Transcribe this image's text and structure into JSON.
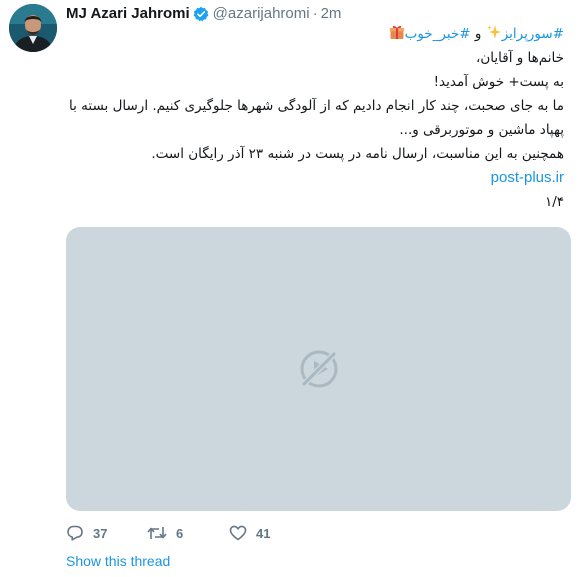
{
  "tweet": {
    "author": {
      "display_name": "MJ Azari Jahromi",
      "handle": "@azarijahromi",
      "verified": true
    },
    "separator": "·",
    "time": "2m",
    "text": {
      "hashtag_1": "#سورپرایز",
      "hashtag_1_emoji": "sparkles-icon",
      "conjunction": "و",
      "hashtag_2": "#خبر_خوب",
      "hashtag_2_emoji": "gift-icon",
      "line_2": "خانم‌ها و آقایان،",
      "line_3": "به پست+ خوش آمدید!",
      "line_4": "ما به جای صحبت، چند کار انجام دادیم که از آلودگی شهرها جلوگیری کنیم. ارسال بسته با",
      "line_5": "پهپاد ماشین و موتوربرقی و...",
      "line_6": "همچنین به این مناسبت، ارسال نامه در پست در شنبه ۲۳ آذر رایگان است.",
      "link": "post-plus.ir",
      "thread_index": "۱/۴"
    },
    "media": {
      "type": "video-placeholder",
      "icon": "video-unavailable-icon",
      "background": "#ccd6dd"
    },
    "actions": {
      "replies": "37",
      "retweets": "6",
      "likes": "41"
    },
    "show_thread_label": "Show this thread"
  },
  "colors": {
    "link": "#1b95e0",
    "secondary_text": "#657786",
    "primary_text": "#14171a",
    "media_placeholder": "#ccd6dd"
  }
}
